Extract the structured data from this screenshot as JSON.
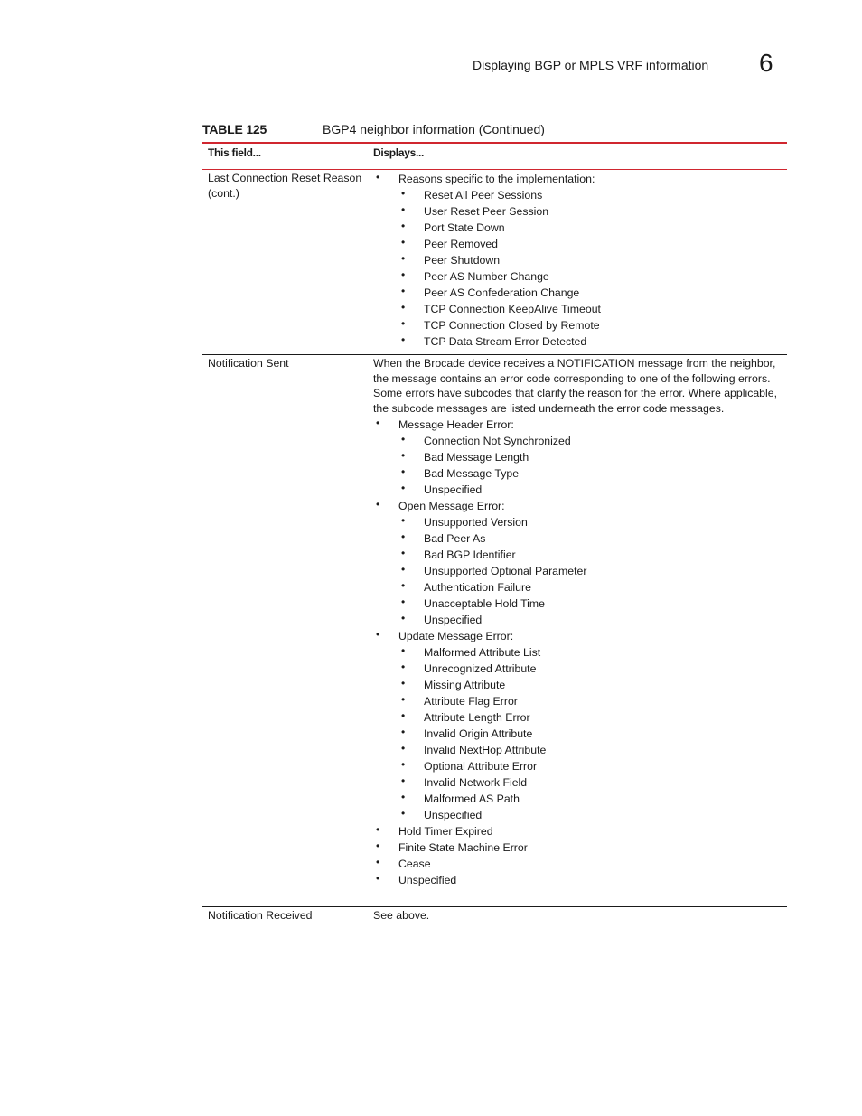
{
  "header": {
    "running_title": "Displaying BGP or MPLS VRF information",
    "chapter_number": "6"
  },
  "table": {
    "label": "TABLE 125",
    "caption": "BGP4 neighbor information  (Continued)",
    "col_headers": [
      "This field...",
      "Displays..."
    ],
    "rows": [
      {
        "field": "Last Connection Reset Reason (cont.)",
        "items": [
          {
            "level": 1,
            "text": "Reasons specific to the implementation:"
          },
          {
            "level": 2,
            "text": "Reset All Peer Sessions"
          },
          {
            "level": 2,
            "text": "User Reset Peer Session"
          },
          {
            "level": 2,
            "text": "Port State Down"
          },
          {
            "level": 2,
            "text": "Peer Removed"
          },
          {
            "level": 2,
            "text": "Peer Shutdown"
          },
          {
            "level": 2,
            "text": "Peer AS Number Change"
          },
          {
            "level": 2,
            "text": "Peer AS Confederation Change"
          },
          {
            "level": 2,
            "text": "TCP Connection KeepAlive Timeout"
          },
          {
            "level": 2,
            "text": "TCP Connection Closed by Remote"
          },
          {
            "level": 2,
            "text": "TCP Data Stream Error Detected"
          }
        ]
      },
      {
        "field": "Notification Sent",
        "paragraph": "When the Brocade device receives a NOTIFICATION message from the neighbor, the message contains an error code corresponding to one of the following errors. Some errors have subcodes that clarify the reason for the error. Where applicable, the subcode messages are listed underneath the error code messages.",
        "items": [
          {
            "level": 1,
            "text": "Message Header Error:"
          },
          {
            "level": 2,
            "text": "Connection Not Synchronized"
          },
          {
            "level": 2,
            "text": "Bad Message Length"
          },
          {
            "level": 2,
            "text": "Bad Message Type"
          },
          {
            "level": 2,
            "text": "Unspecified"
          },
          {
            "level": 1,
            "text": "Open Message Error:"
          },
          {
            "level": 2,
            "text": "Unsupported Version"
          },
          {
            "level": 2,
            "text": "Bad Peer As"
          },
          {
            "level": 2,
            "text": "Bad BGP Identifier"
          },
          {
            "level": 2,
            "text": "Unsupported Optional Parameter"
          },
          {
            "level": 2,
            "text": "Authentication Failure"
          },
          {
            "level": 2,
            "text": "Unacceptable Hold Time"
          },
          {
            "level": 2,
            "text": "Unspecified"
          },
          {
            "level": 1,
            "text": "Update Message Error:"
          },
          {
            "level": 2,
            "text": "Malformed Attribute List"
          },
          {
            "level": 2,
            "text": "Unrecognized Attribute"
          },
          {
            "level": 2,
            "text": "Missing Attribute"
          },
          {
            "level": 2,
            "text": "Attribute Flag Error"
          },
          {
            "level": 2,
            "text": "Attribute Length Error"
          },
          {
            "level": 2,
            "text": "Invalid Origin Attribute"
          },
          {
            "level": 2,
            "text": "Invalid NextHop Attribute"
          },
          {
            "level": 2,
            "text": "Optional Attribute Error"
          },
          {
            "level": 2,
            "text": "Invalid Network Field"
          },
          {
            "level": 2,
            "text": "Malformed AS Path"
          },
          {
            "level": 2,
            "text": "Unspecified"
          },
          {
            "level": 1,
            "text": "Hold Timer Expired"
          },
          {
            "level": 1,
            "text": "Finite State Machine Error"
          },
          {
            "level": 1,
            "text": "Cease"
          },
          {
            "level": 1,
            "text": "Unspecified"
          }
        ]
      },
      {
        "field": "Notification Received",
        "text": "See above."
      }
    ]
  },
  "colors": {
    "rule_red": "#d0262f",
    "text": "#1a1a1a"
  }
}
